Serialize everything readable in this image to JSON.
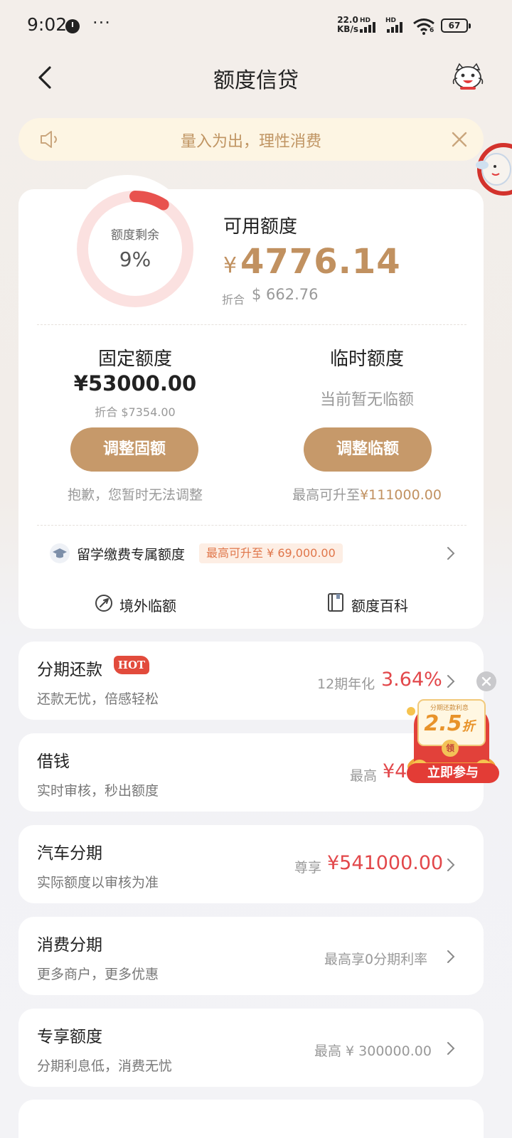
{
  "status_bar": {
    "time": "9:02",
    "dots": "···",
    "net_speed_value": "22.0",
    "net_speed_unit": "KB/s",
    "hd1": "HD",
    "hd2": "HD",
    "wifi_badge": "6",
    "battery": "67"
  },
  "nav": {
    "title": "额度信贷",
    "back_icon": "chevron-left-icon",
    "mascot_icon": "mascot-cat-icon"
  },
  "notice": {
    "text": "量入为出，理性消费",
    "icon": "speaker-icon",
    "close_icon": "close-icon"
  },
  "quota": {
    "ring_label": "额度剩余",
    "ring_percent": "9%",
    "ring_fraction": 0.09,
    "available_label": "可用额度",
    "available_currency": "¥",
    "available_amount": "4776.14",
    "usd_label": "折合",
    "usd_amount": "$ 662.76",
    "fixed": {
      "title": "固定额度",
      "amount": "¥53000.00",
      "usd": "折合 $7354.00",
      "button": "调整固额",
      "note": "抱歉，您暂时无法调整"
    },
    "temporary": {
      "title": "临时额度",
      "status": "当前暂无临额",
      "button": "调整临额",
      "note_prefix": "最高可升至",
      "note_amount": "¥111000.00"
    },
    "study_abroad": {
      "label": "留学缴费专属额度",
      "badge": "最高可升至 ¥ 69,000.00"
    },
    "links": {
      "overseas": "境外临额",
      "encyclopedia": "额度百科"
    }
  },
  "products": [
    {
      "title": "分期还款",
      "badge": "HOT",
      "subtitle": "还款无忧，倍感轻松",
      "right_prefix": "12期年化",
      "right_value": "3.64%"
    },
    {
      "title": "借钱",
      "subtitle": "实时审核，秒出额度",
      "right_prefix": "最高",
      "right_value": "¥4"
    },
    {
      "title": "汽车分期",
      "subtitle": "实际额度以审核为准",
      "right_prefix": "尊享",
      "right_value": "¥541000.00"
    },
    {
      "title": "消费分期",
      "subtitle": "更多商户，更多优惠",
      "right_text": "最高享0分期利率"
    },
    {
      "title": "专享额度",
      "subtitle": "分期利息低，消费无忧",
      "right_text": "最高 ¥ 300000.00"
    }
  ],
  "promo": {
    "caption": "分期还款利息",
    "discount": "2.5",
    "discount_unit": "折",
    "ling": "领",
    "button": "立即参与"
  },
  "colors": {
    "gold": "#c6996a",
    "gold_text": "#c19160",
    "red": "#e2474a",
    "ring_track": "#fbe1e0",
    "ring_fill": "#e8524e"
  }
}
